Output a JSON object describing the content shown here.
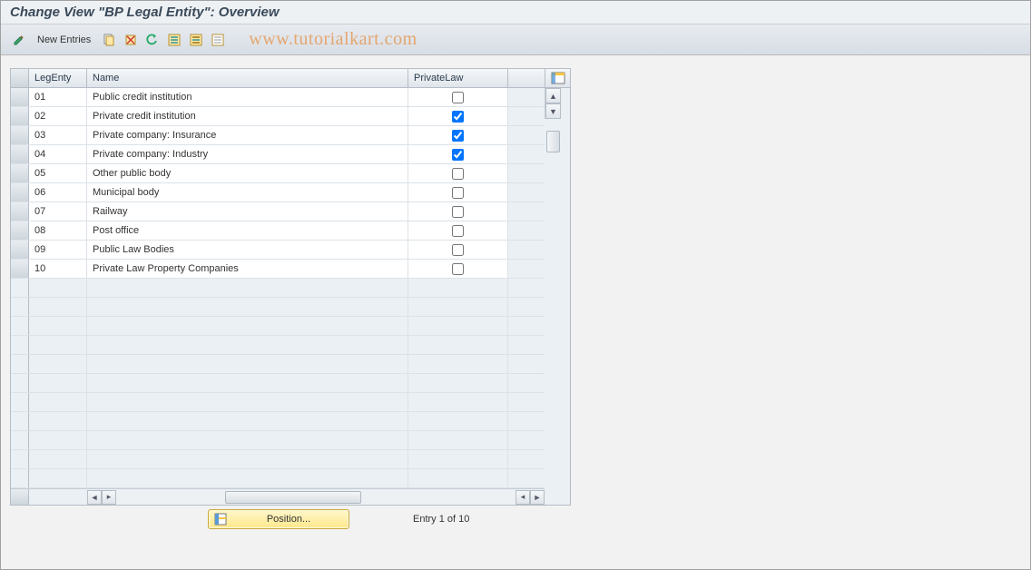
{
  "title": "Change View \"BP Legal Entity\": Overview",
  "toolbar": {
    "new_entries": "New Entries"
  },
  "watermark": "www.tutorialkart.com",
  "columns": {
    "leg_entity": "LegEnty",
    "name": "Name",
    "private_law": "PrivateLaw"
  },
  "rows": [
    {
      "code": "01",
      "name": "Public credit institution",
      "private_law": false
    },
    {
      "code": "02",
      "name": "Private credit institution",
      "private_law": true
    },
    {
      "code": "03",
      "name": "Private company: Insurance",
      "private_law": true
    },
    {
      "code": "04",
      "name": "Private company: Industry",
      "private_law": true
    },
    {
      "code": "05",
      "name": "Other public body",
      "private_law": false
    },
    {
      "code": "06",
      "name": "Municipal body",
      "private_law": false
    },
    {
      "code": "07",
      "name": "Railway",
      "private_law": false
    },
    {
      "code": "08",
      "name": "Post office",
      "private_law": false
    },
    {
      "code": "09",
      "name": "Public Law Bodies",
      "private_law": false
    },
    {
      "code": "10",
      "name": "Private Law Property Companies",
      "private_law": false
    }
  ],
  "empty_rows": 11,
  "footer": {
    "position_button": "Position...",
    "entry_label": "Entry 1 of 10"
  }
}
